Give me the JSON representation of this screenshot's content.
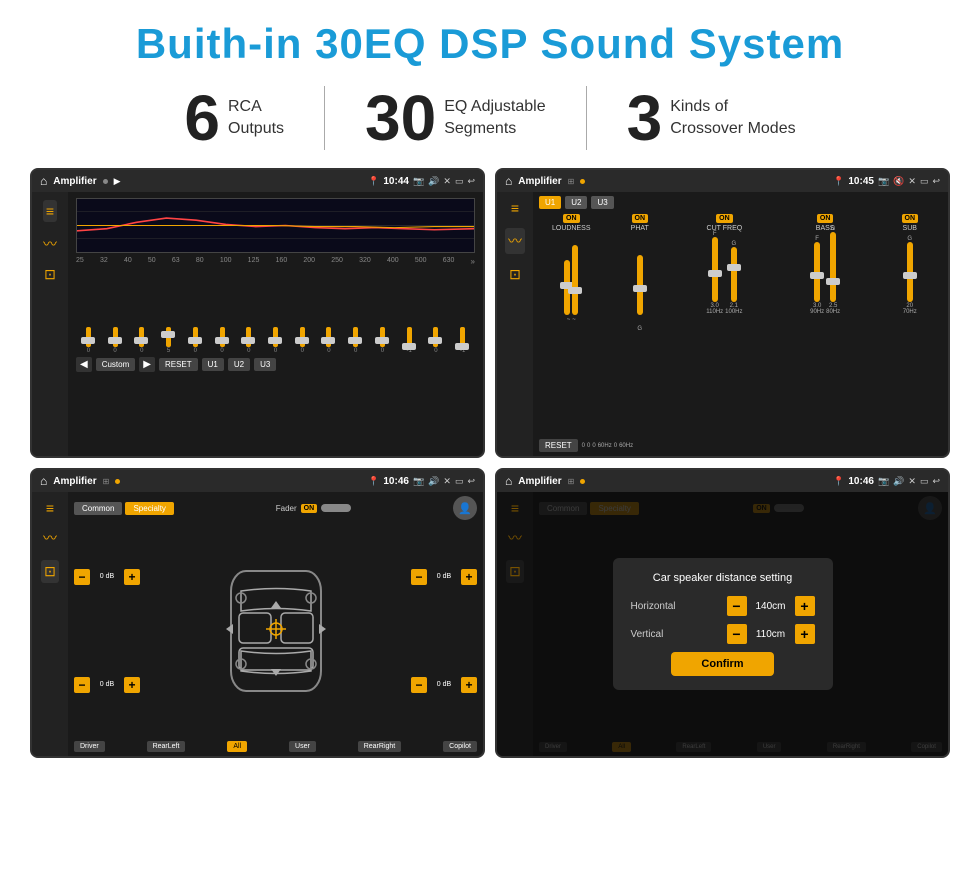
{
  "page": {
    "title": "Buith-in 30EQ DSP Sound System",
    "features": [
      {
        "number": "6",
        "desc": "RCA\nOutputs"
      },
      {
        "number": "30",
        "desc": "EQ Adjustable\nSegments"
      },
      {
        "number": "3",
        "desc": "Kinds of\nCrossover Modes"
      }
    ]
  },
  "screens": {
    "screen1": {
      "status_title": "Amplifier",
      "time": "10:44",
      "eq_freqs": [
        "25",
        "32",
        "40",
        "50",
        "63",
        "80",
        "100",
        "125",
        "160",
        "200",
        "250",
        "320",
        "400",
        "500",
        "630"
      ],
      "eq_vals": [
        "0",
        "0",
        "0",
        "5",
        "0",
        "0",
        "0",
        "0",
        "0",
        "0",
        "0",
        "0",
        "-1",
        "0",
        "-1"
      ],
      "buttons": [
        "Custom",
        "RESET",
        "U1",
        "U2",
        "U3"
      ]
    },
    "screen2": {
      "status_title": "Amplifier",
      "time": "10:45",
      "presets": [
        "U1",
        "U2",
        "U3"
      ],
      "controls": [
        {
          "label": "LOUDNESS",
          "on": true
        },
        {
          "label": "PHAT",
          "on": true
        },
        {
          "label": "CUT FREQ",
          "on": true
        },
        {
          "label": "BASS",
          "on": true
        },
        {
          "label": "SUB",
          "on": true
        }
      ],
      "reset_btn": "RESET"
    },
    "screen3": {
      "status_title": "Amplifier",
      "time": "10:46",
      "tabs": [
        "Common",
        "Specialty"
      ],
      "fader_label": "Fader",
      "fader_on": "ON",
      "vol_rows": [
        {
          "val": "0 dB"
        },
        {
          "val": "0 dB"
        },
        {
          "val": "0 dB"
        },
        {
          "val": "0 dB"
        }
      ],
      "bottom_btns": [
        "Driver",
        "RearLeft",
        "All",
        "User",
        "RearRight",
        "Copilot"
      ]
    },
    "screen4": {
      "status_title": "Amplifier",
      "time": "10:46",
      "tabs": [
        "Common",
        "Specialty"
      ],
      "fader_on": "ON",
      "dialog": {
        "title": "Car speaker distance setting",
        "horizontal_label": "Horizontal",
        "horizontal_val": "140cm",
        "vertical_label": "Vertical",
        "vertical_val": "110cm",
        "confirm_btn": "Confirm"
      },
      "bottom_btns": [
        "Driver",
        "RearLeft",
        "All",
        "User",
        "RearRight",
        "Copilot"
      ]
    }
  },
  "colors": {
    "accent": "#f0a500",
    "dark_bg": "#1a1a1a",
    "title_blue": "#1a9bd7"
  }
}
